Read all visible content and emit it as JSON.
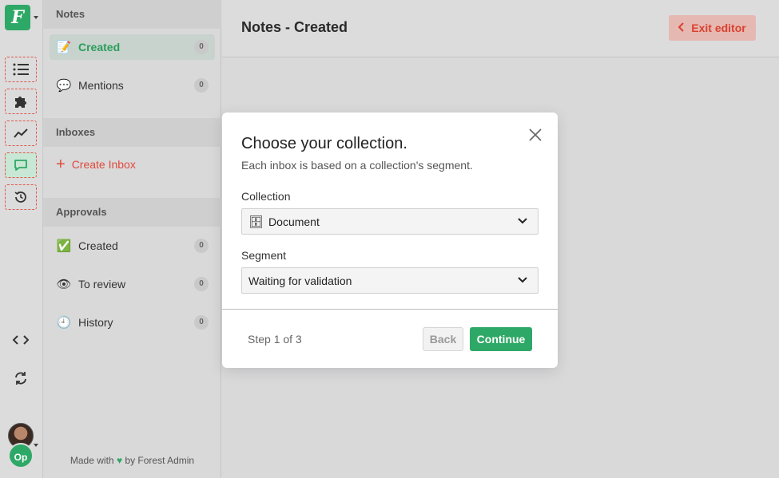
{
  "sidebar": {
    "logo_letter": "F",
    "avatar_badge": "Op",
    "icons": [
      "list-icon",
      "puzzle-icon",
      "chart-line-icon",
      "chat-icon",
      "history-icon",
      "code-icon",
      "sync-icon"
    ]
  },
  "panel": {
    "notes_header": "Notes",
    "notes_items": [
      {
        "label": "Created",
        "count": "0",
        "icon": "📝"
      },
      {
        "label": "Mentions",
        "count": "0",
        "icon": "💬"
      }
    ],
    "inboxes_header": "Inboxes",
    "create_inbox_label": "Create Inbox",
    "approvals_header": "Approvals",
    "approvals_items": [
      {
        "label": "Created",
        "count": "0",
        "icon": "✅"
      },
      {
        "label": "To review",
        "count": "0",
        "icon": "👁"
      },
      {
        "label": "History",
        "count": "0",
        "icon": "🕘"
      }
    ],
    "made_with_prefix": "Made with",
    "made_with_suffix": "by Forest Admin"
  },
  "header": {
    "title": "Notes - Created",
    "exit_label": "Exit editor"
  },
  "modal": {
    "title": "Choose your collection.",
    "subtitle": "Each inbox is based on a collection's segment.",
    "collection_label": "Collection",
    "collection_value": "Document",
    "collection_icon": "🗄",
    "segment_label": "Segment",
    "segment_value": "Waiting for validation",
    "step_text": "Step 1 of 3",
    "back_label": "Back",
    "continue_label": "Continue"
  },
  "colors": {
    "brand_green": "#2ea866",
    "danger_red": "#e0493b"
  }
}
